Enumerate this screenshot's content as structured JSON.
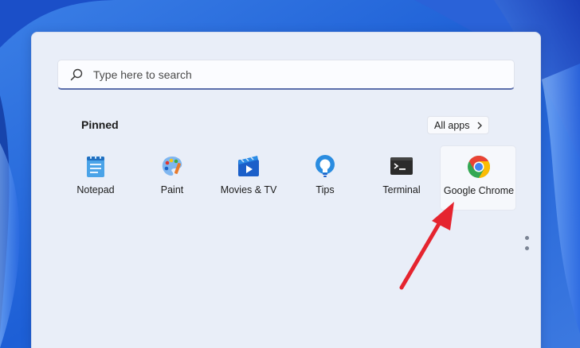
{
  "search": {
    "placeholder": "Type here to search"
  },
  "pinned": {
    "title": "Pinned",
    "all_apps_label": "All apps",
    "apps": [
      {
        "label": "Notepad",
        "icon": "notepad-icon"
      },
      {
        "label": "Paint",
        "icon": "paint-icon"
      },
      {
        "label": "Movies & TV",
        "icon": "movies-tv-icon"
      },
      {
        "label": "Tips",
        "icon": "tips-icon"
      },
      {
        "label": "Terminal",
        "icon": "terminal-icon"
      },
      {
        "label": "Google Chrome",
        "icon": "chrome-icon",
        "selected": true
      }
    ]
  },
  "colors": {
    "accent": "#5b6eab",
    "annotation_arrow": "#e5242f",
    "menu_background": "#e9eef8"
  }
}
